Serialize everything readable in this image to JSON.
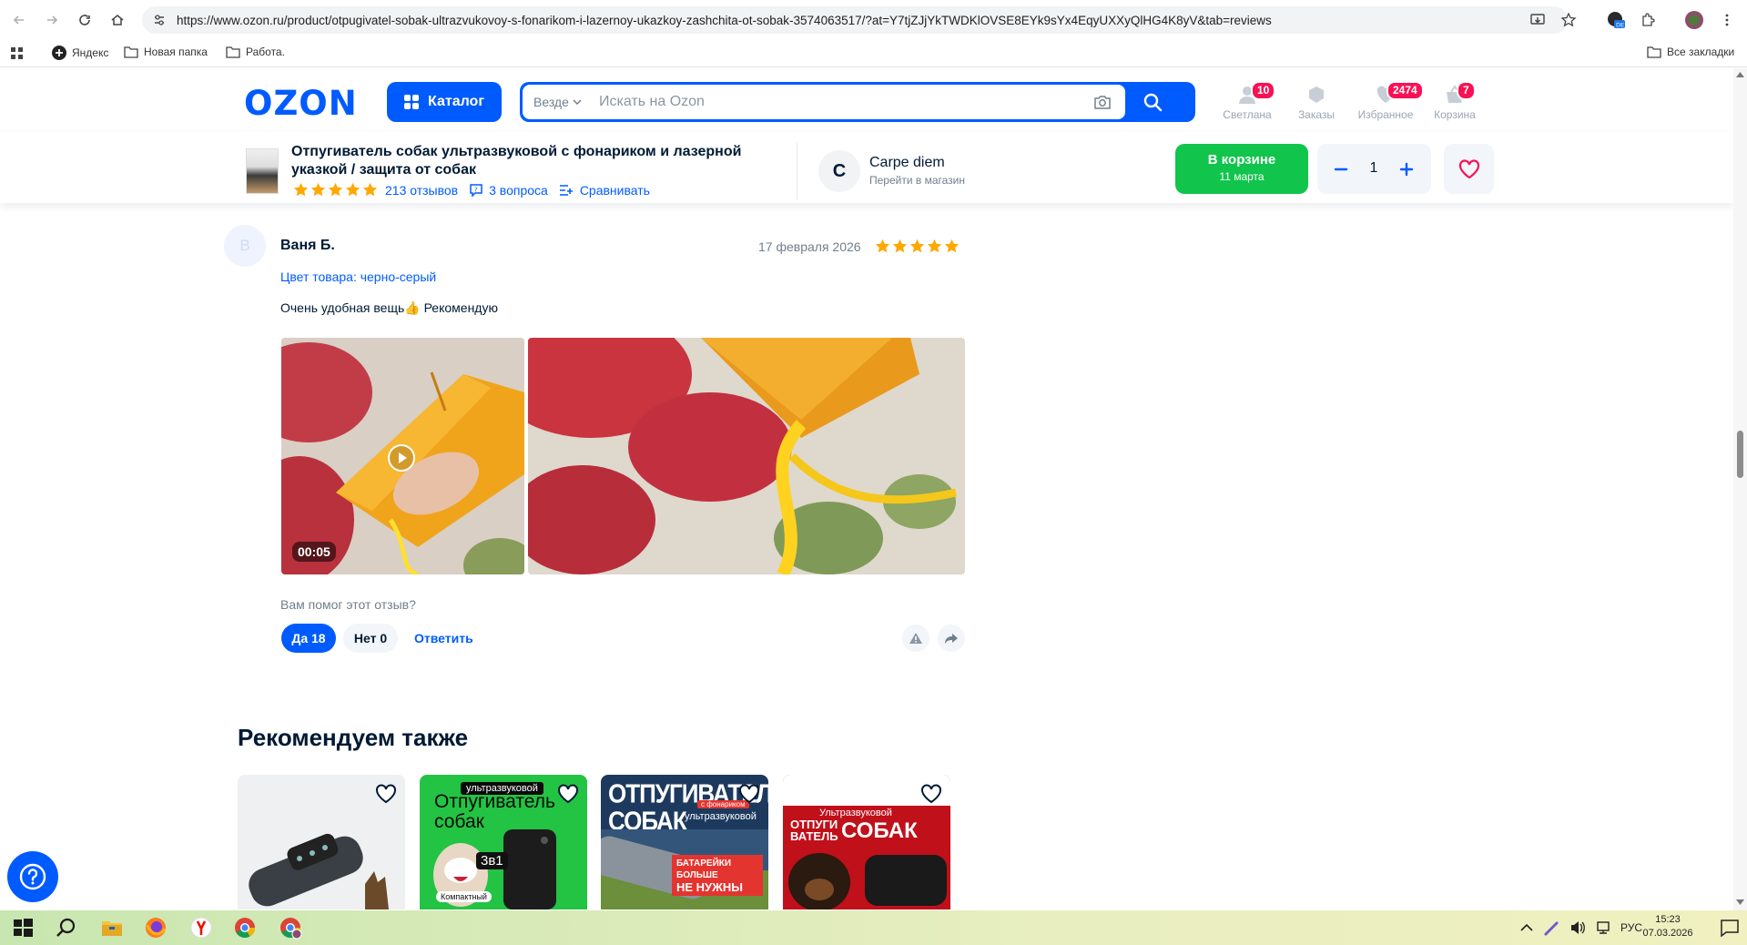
{
  "browser": {
    "url": "https://www.ozon.ru/product/otpugivatel-sobak-ultrazvukovoy-s-fonarikom-i-lazernoy-ukazkoy-zashchita-ot-sobak-3574063517/?at=Y7tjZJjYkTWDKlOVSE8EYk9sYx4EqyUXXyQlHG4K8yV&tab=reviews",
    "bookmarks": [
      "Яндекс",
      "Новая папка",
      "Работа."
    ],
    "all_bookmarks": "Все закладки"
  },
  "header": {
    "logo": "OZON",
    "catalog_label": "Каталог",
    "search_scope": "Везде",
    "search_placeholder": "Искать на Ozon",
    "items": [
      {
        "label": "Светлана",
        "badge": "10"
      },
      {
        "label": "Заказы",
        "badge": ""
      },
      {
        "label": "Избранное",
        "badge": "2474"
      },
      {
        "label": "Корзина",
        "badge": "7"
      }
    ]
  },
  "product_bar": {
    "title": "Отпугиватель собак ультразвуковой с фонариком и лазерной указкой / защита от собак",
    "reviews": "213 отзывов",
    "questions": "3 вопроса",
    "compare": "Сравнивать",
    "seller_initial": "C",
    "seller_name": "Carpe diem",
    "seller_link": "Перейти в магазин",
    "cart_line1": "В корзине",
    "cart_line2": "11 марта",
    "quantity": "1"
  },
  "review": {
    "avatar_initial": "В",
    "author": "Ваня Б.",
    "date": "17 февраля 2026",
    "rating": 5,
    "color": "Цвет товара: черно-серый",
    "text": "Очень удобная вещь👍 Рекомендую",
    "video_duration": "00:05",
    "helpful_question": "Вам помог этот отзыв?",
    "yes_label": "Да 18",
    "no_label": "Нет 0",
    "reply_label": "Ответить"
  },
  "recommend": {
    "title": "Рекомендуем также",
    "cards": [
      {
        "lines": []
      },
      {
        "lines": [
          "ультразвуковой",
          "Отпугиватель",
          "собак",
          "3в1",
          "Компактный"
        ]
      },
      {
        "lines": [
          "ОТПУГИВАТЕЛЬ",
          "СОБАК",
          "с фонариком",
          "ультразвуковой",
          "БАТАРЕЙКИ БОЛЬШЕ",
          "НЕ НУЖНЫ"
        ]
      },
      {
        "lines": [
          "Ультразвуковой",
          "ОТПУГИ",
          "ВАТЕЛЬ",
          "СОБАК"
        ]
      }
    ]
  },
  "taskbar": {
    "lang": "РУС",
    "time": "15:23",
    "date": "07.03.2026"
  },
  "colors": {
    "ozon_blue": "#005bff",
    "cart_green": "#10c44c",
    "badge_pink": "#f91155",
    "star_orange": "#ffa800"
  }
}
